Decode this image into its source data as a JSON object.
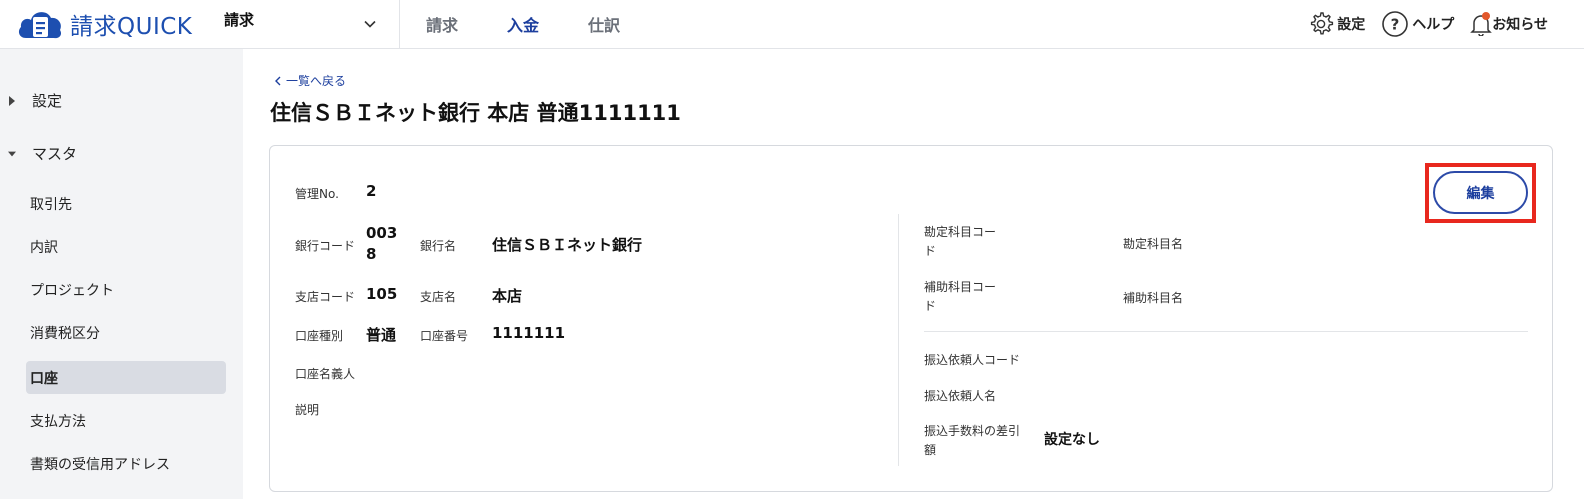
{
  "header": {
    "logo_text": "請求QUICK",
    "app_select_label": "請求",
    "nav": [
      {
        "label": "請求",
        "active": false
      },
      {
        "label": "入金",
        "active": true
      },
      {
        "label": "仕訳",
        "active": false
      }
    ],
    "tools": {
      "settings_label": "設定",
      "help_label": "ヘルプ",
      "notifications_label": "お知らせ"
    }
  },
  "sidebar": {
    "groups": [
      {
        "label": "設定",
        "expanded": false
      },
      {
        "label": "マスタ",
        "expanded": true
      }
    ],
    "items": [
      {
        "label": "取引先"
      },
      {
        "label": "内訳"
      },
      {
        "label": "プロジェクト"
      },
      {
        "label": "消費税区分"
      },
      {
        "label": "口座",
        "active": true
      },
      {
        "label": "支払方法"
      },
      {
        "label": "書類の受信用アドレス"
      }
    ]
  },
  "main": {
    "back_link": "一覧へ戻る",
    "title": "住信ＳＢＩネット銀行 本店 普通1111111",
    "edit_button": "編集",
    "fields": {
      "management_no_label": "管理No.",
      "management_no_value": "2",
      "bank_code_label": "銀行コード",
      "bank_code_value_line1": "003",
      "bank_code_value_line2": "8",
      "bank_name_label": "銀行名",
      "bank_name_value": "住信ＳＢＩネット銀行",
      "branch_code_label": "支店コード",
      "branch_code_value": "105",
      "branch_name_label": "支店名",
      "branch_name_value": "本店",
      "account_type_label": "口座種別",
      "account_type_value": "普通",
      "account_number_label": "口座番号",
      "account_number_value": "1111111",
      "account_holder_label": "口座名義人",
      "description_label": "説明",
      "account_title_code_label_line1": "勘定科目コー",
      "account_title_code_label_line2": "ド",
      "account_title_name_label": "勘定科目名",
      "sub_account_code_label_line1": "補助科目コー",
      "sub_account_code_label_line2": "ド",
      "sub_account_name_label": "補助科目名",
      "transfer_requester_code_label": "振込依頼人コード",
      "transfer_requester_name_label": "振込依頼人名",
      "transfer_fee_label_line1": "振込手数料の差引",
      "transfer_fee_label_line2": "額",
      "transfer_fee_value": "設定なし"
    }
  },
  "colors": {
    "brand_blue": "#1d4fb0",
    "nav_active": "#1d3f9e",
    "highlight_red": "#e8281e",
    "sidebar_bg": "#f3f4f6",
    "sidebar_active_bg": "#d9dce3",
    "notification_dot": "#e2572b"
  }
}
